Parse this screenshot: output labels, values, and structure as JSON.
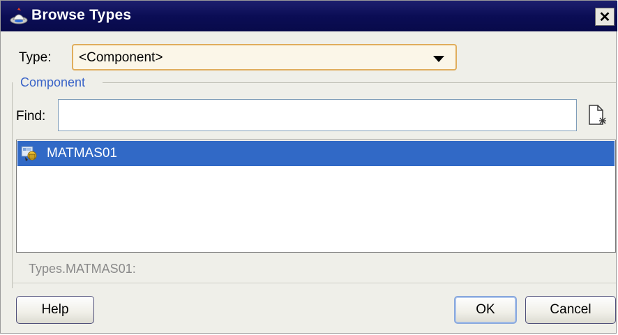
{
  "window": {
    "title": "Browse Types",
    "close_glyph": "✕"
  },
  "type_row": {
    "label": "Type:",
    "selected": "<Component>"
  },
  "component_group": {
    "legend": "Component",
    "find_label": "Find:",
    "find_value": "",
    "list": [
      {
        "label": "MATMAS01",
        "selected": true,
        "icon": "component-type-icon"
      }
    ],
    "status": "Types.MATMAS01:"
  },
  "buttons": {
    "help": "Help",
    "ok": "OK",
    "cancel": "Cancel"
  },
  "colors": {
    "title_bar": "#0b0d55",
    "selection": "#3169c6",
    "legend": "#3a64c8",
    "select_border": "#e0ad5c"
  }
}
